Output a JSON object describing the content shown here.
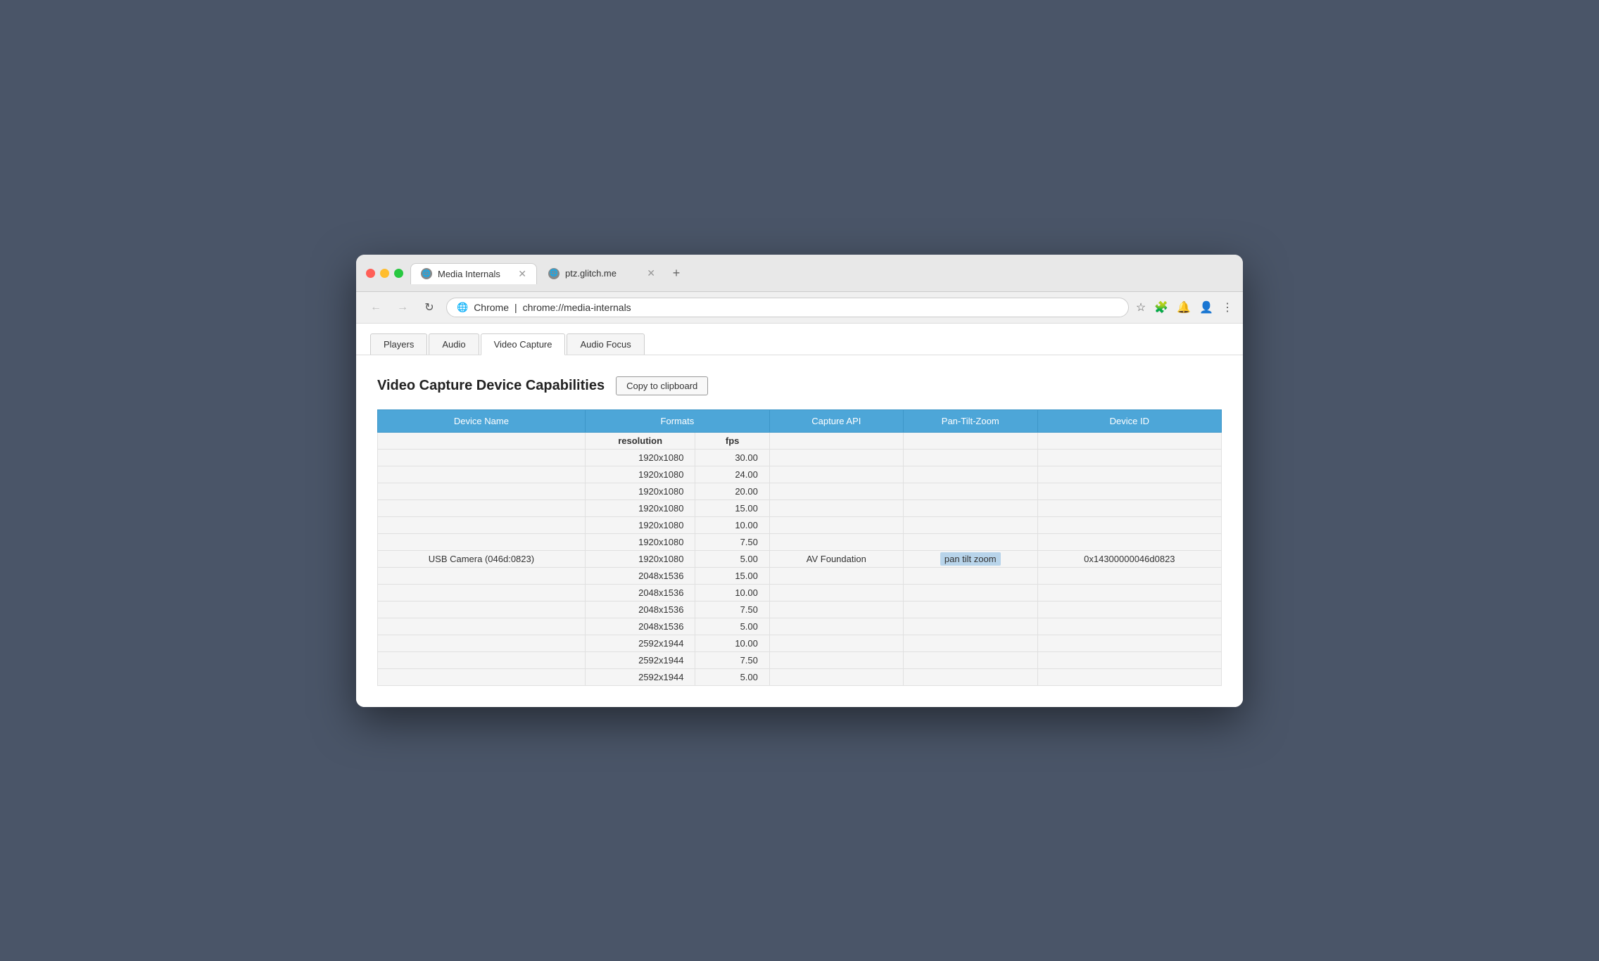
{
  "window": {
    "title": "Media Internals"
  },
  "browser": {
    "tabs": [
      {
        "id": "tab1",
        "label": "Media Internals",
        "active": true,
        "icon": "🌐"
      },
      {
        "id": "tab2",
        "label": "ptz.glitch.me",
        "active": false,
        "icon": "🌐"
      }
    ],
    "new_tab_icon": "+",
    "nav": {
      "back": "←",
      "forward": "→",
      "reload": "↻"
    },
    "address": {
      "domain": "Chrome",
      "url": "chrome://media-internals"
    },
    "toolbar": {
      "star": "☆",
      "extensions": "🧩",
      "notifications": "🔔",
      "profile": "👤",
      "menu": "⋮"
    }
  },
  "chrome_tabs": [
    {
      "id": "players",
      "label": "Players",
      "active": false
    },
    {
      "id": "audio",
      "label": "Audio",
      "active": false
    },
    {
      "id": "video-capture",
      "label": "Video Capture",
      "active": true
    },
    {
      "id": "audio-focus",
      "label": "Audio Focus",
      "active": false
    }
  ],
  "section": {
    "title": "Video Capture Device Capabilities",
    "copy_button": "Copy to clipboard"
  },
  "table": {
    "headers": [
      "Device Name",
      "Formats",
      "Capture API",
      "Pan-Tilt-Zoom",
      "Device ID"
    ],
    "sub_headers": [
      "resolution",
      "fps"
    ],
    "rows": [
      {
        "device": "",
        "resolution": "1920x1080",
        "fps": "30.00",
        "api": "",
        "ptz": "",
        "device_id": ""
      },
      {
        "device": "",
        "resolution": "1920x1080",
        "fps": "24.00",
        "api": "",
        "ptz": "",
        "device_id": ""
      },
      {
        "device": "",
        "resolution": "1920x1080",
        "fps": "20.00",
        "api": "",
        "ptz": "",
        "device_id": ""
      },
      {
        "device": "",
        "resolution": "1920x1080",
        "fps": "15.00",
        "api": "",
        "ptz": "",
        "device_id": ""
      },
      {
        "device": "",
        "resolution": "1920x1080",
        "fps": "10.00",
        "api": "",
        "ptz": "",
        "device_id": ""
      },
      {
        "device": "",
        "resolution": "1920x1080",
        "fps": "7.50",
        "api": "",
        "ptz": "",
        "device_id": ""
      },
      {
        "device": "USB Camera (046d:0823)",
        "resolution": "1920x1080",
        "fps": "5.00",
        "api": "AV Foundation",
        "ptz": "pan tilt zoom",
        "device_id": "0x14300000046d0823"
      },
      {
        "device": "",
        "resolution": "2048x1536",
        "fps": "15.00",
        "api": "",
        "ptz": "",
        "device_id": ""
      },
      {
        "device": "",
        "resolution": "2048x1536",
        "fps": "10.00",
        "api": "",
        "ptz": "",
        "device_id": ""
      },
      {
        "device": "",
        "resolution": "2048x1536",
        "fps": "7.50",
        "api": "",
        "ptz": "",
        "device_id": ""
      },
      {
        "device": "",
        "resolution": "2048x1536",
        "fps": "5.00",
        "api": "",
        "ptz": "",
        "device_id": ""
      },
      {
        "device": "",
        "resolution": "2592x1944",
        "fps": "10.00",
        "api": "",
        "ptz": "",
        "device_id": ""
      },
      {
        "device": "",
        "resolution": "2592x1944",
        "fps": "7.50",
        "api": "",
        "ptz": "",
        "device_id": ""
      },
      {
        "device": "",
        "resolution": "2592x1944",
        "fps": "5.00",
        "api": "",
        "ptz": "",
        "device_id": ""
      }
    ],
    "middle_row_index": 6,
    "colors": {
      "header_bg": "#4da6d8",
      "ptz_highlight": "#b8d4ea"
    }
  }
}
